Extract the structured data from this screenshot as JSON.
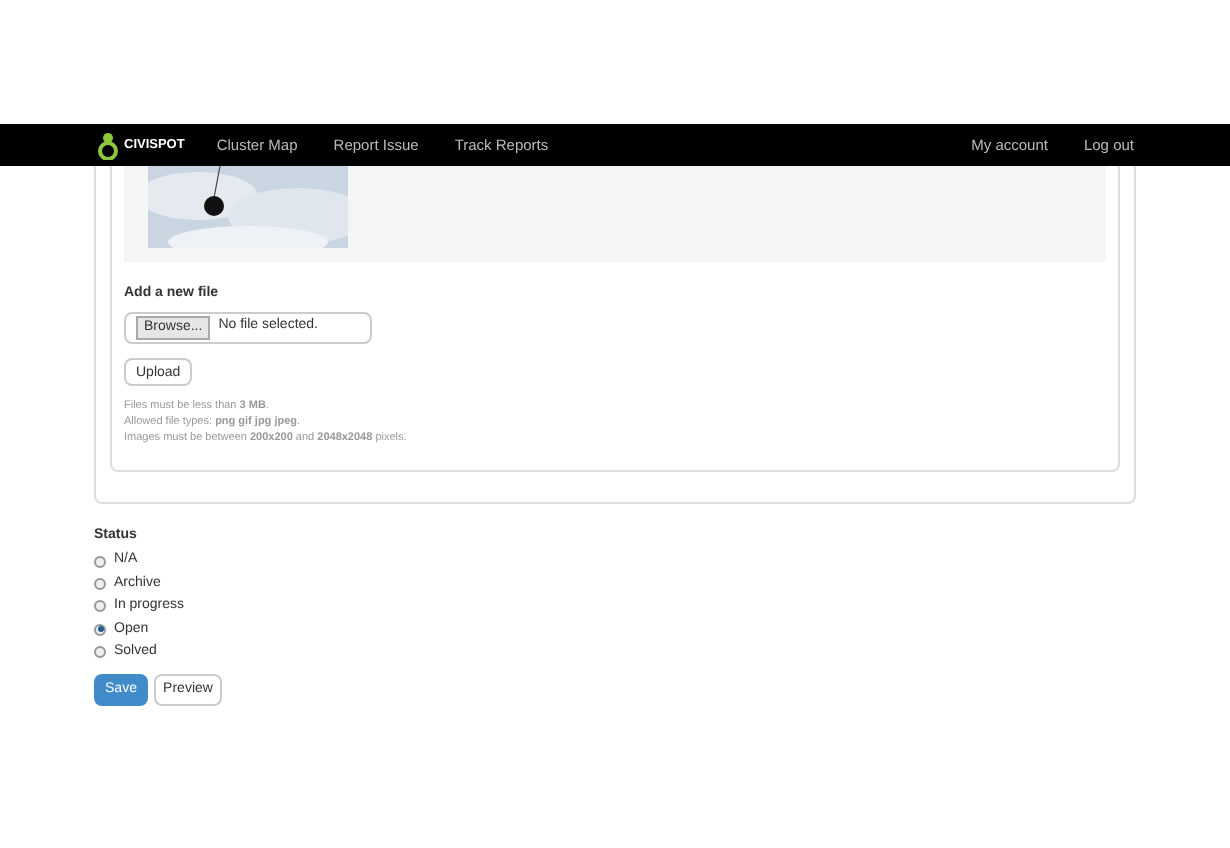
{
  "navbar": {
    "logo": "CIVISPOT",
    "links": [
      {
        "label": "Cluster Map"
      },
      {
        "label": "Report Issue"
      },
      {
        "label": "Track Reports"
      }
    ],
    "right_links": [
      {
        "label": "My account"
      },
      {
        "label": "Log out"
      }
    ]
  },
  "upload": {
    "heading": "Add a new file",
    "browse_button": "Browse...",
    "file_status": "No file selected.",
    "upload_button": "Upload",
    "help": [
      "Files must be less than **3 MB**.",
      "Allowed file types: **png gif jpg jpeg**.",
      "Images must be between **200x200** and **2048x2048** pixels."
    ]
  },
  "status": {
    "label": "Status",
    "options": [
      {
        "label": "N/A",
        "selected": false
      },
      {
        "label": "Archive",
        "selected": false
      },
      {
        "label": "In progress",
        "selected": false
      },
      {
        "label": "Open",
        "selected": true
      },
      {
        "label": "Solved",
        "selected": false
      }
    ]
  },
  "actions": {
    "save": "Save",
    "preview": "Preview"
  }
}
